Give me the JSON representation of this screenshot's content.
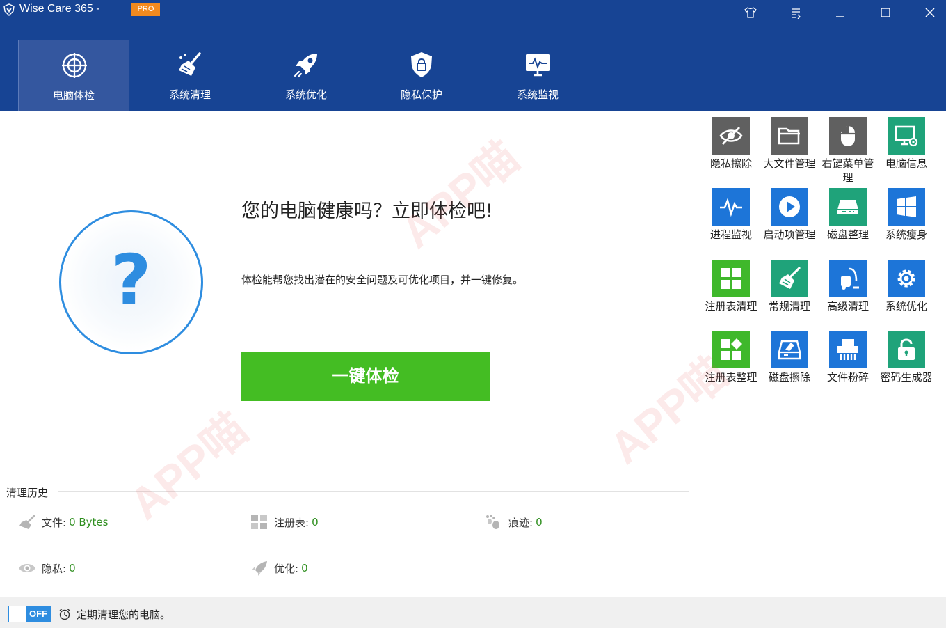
{
  "window": {
    "title": "Wise Care 365 -",
    "badge": "PRO",
    "controls": [
      "skin-icon",
      "menu-icon",
      "minimize-icon",
      "maximize-icon",
      "close-icon"
    ]
  },
  "tabs": [
    {
      "label": "电脑体检",
      "icon": "target-icon",
      "active": true
    },
    {
      "label": "系统清理",
      "icon": "broom-icon",
      "active": false
    },
    {
      "label": "系统优化",
      "icon": "rocket-icon",
      "active": false
    },
    {
      "label": "隐私保护",
      "icon": "shield-lock-icon",
      "active": false
    },
    {
      "label": "系统监视",
      "icon": "monitor-icon",
      "active": false
    }
  ],
  "main": {
    "headline": "您的电脑健康吗？立即体检吧!",
    "description": "体检能帮您找出潜在的安全问题及可优化项目，并一键修复。",
    "scan_button": "一键体检",
    "status_symbol": "?"
  },
  "history": {
    "title": "清理历史",
    "items": [
      {
        "label": "文件:",
        "value": "0 Bytes",
        "icon": "broom-icon"
      },
      {
        "label": "注册表:",
        "value": "0",
        "icon": "registry-icon"
      },
      {
        "label": "痕迹:",
        "value": "0",
        "icon": "footprint-icon"
      },
      {
        "label": "隐私:",
        "value": "0",
        "icon": "eye-icon"
      },
      {
        "label": "优化:",
        "value": "0",
        "icon": "rocket-icon"
      }
    ]
  },
  "footer": {
    "toggle_label": "OFF",
    "text": "定期清理您的电脑。"
  },
  "tools": [
    {
      "label": "隐私擦除",
      "icon": "hidden-eye-icon",
      "color": "#606060"
    },
    {
      "label": "大文件管理",
      "icon": "folder-icon",
      "color": "#606060"
    },
    {
      "label": "右键菜单管理",
      "icon": "mouse-icon",
      "color": "#606060"
    },
    {
      "label": "电脑信息",
      "icon": "computer-info-icon",
      "color": "#1fa37a"
    },
    {
      "label": "进程监视",
      "icon": "pulse-icon",
      "color": "#1d75d8"
    },
    {
      "label": "启动项管理",
      "icon": "play-icon",
      "color": "#1d75d8"
    },
    {
      "label": "磁盘整理",
      "icon": "disk-icon",
      "color": "#1fa37a"
    },
    {
      "label": "系统瘦身",
      "icon": "windows-icon",
      "color": "#1d75d8"
    },
    {
      "label": "注册表清理",
      "icon": "grid-icon",
      "color": "#3fb82b"
    },
    {
      "label": "常规清理",
      "icon": "broom-icon",
      "color": "#1fa37a"
    },
    {
      "label": "高级清理",
      "icon": "vacuum-icon",
      "color": "#1d75d8"
    },
    {
      "label": "系统优化",
      "icon": "gear-icon",
      "color": "#1d75d8"
    },
    {
      "label": "注册表整理",
      "icon": "blocks-icon",
      "color": "#3fb82b"
    },
    {
      "label": "磁盘擦除",
      "icon": "disk-eraser-icon",
      "color": "#1d75d8"
    },
    {
      "label": "文件粉碎",
      "icon": "shredder-icon",
      "color": "#1d75d8"
    },
    {
      "label": "密码生成器",
      "icon": "padlock-icon",
      "color": "#1fa37a"
    }
  ],
  "watermark": "APP喵"
}
